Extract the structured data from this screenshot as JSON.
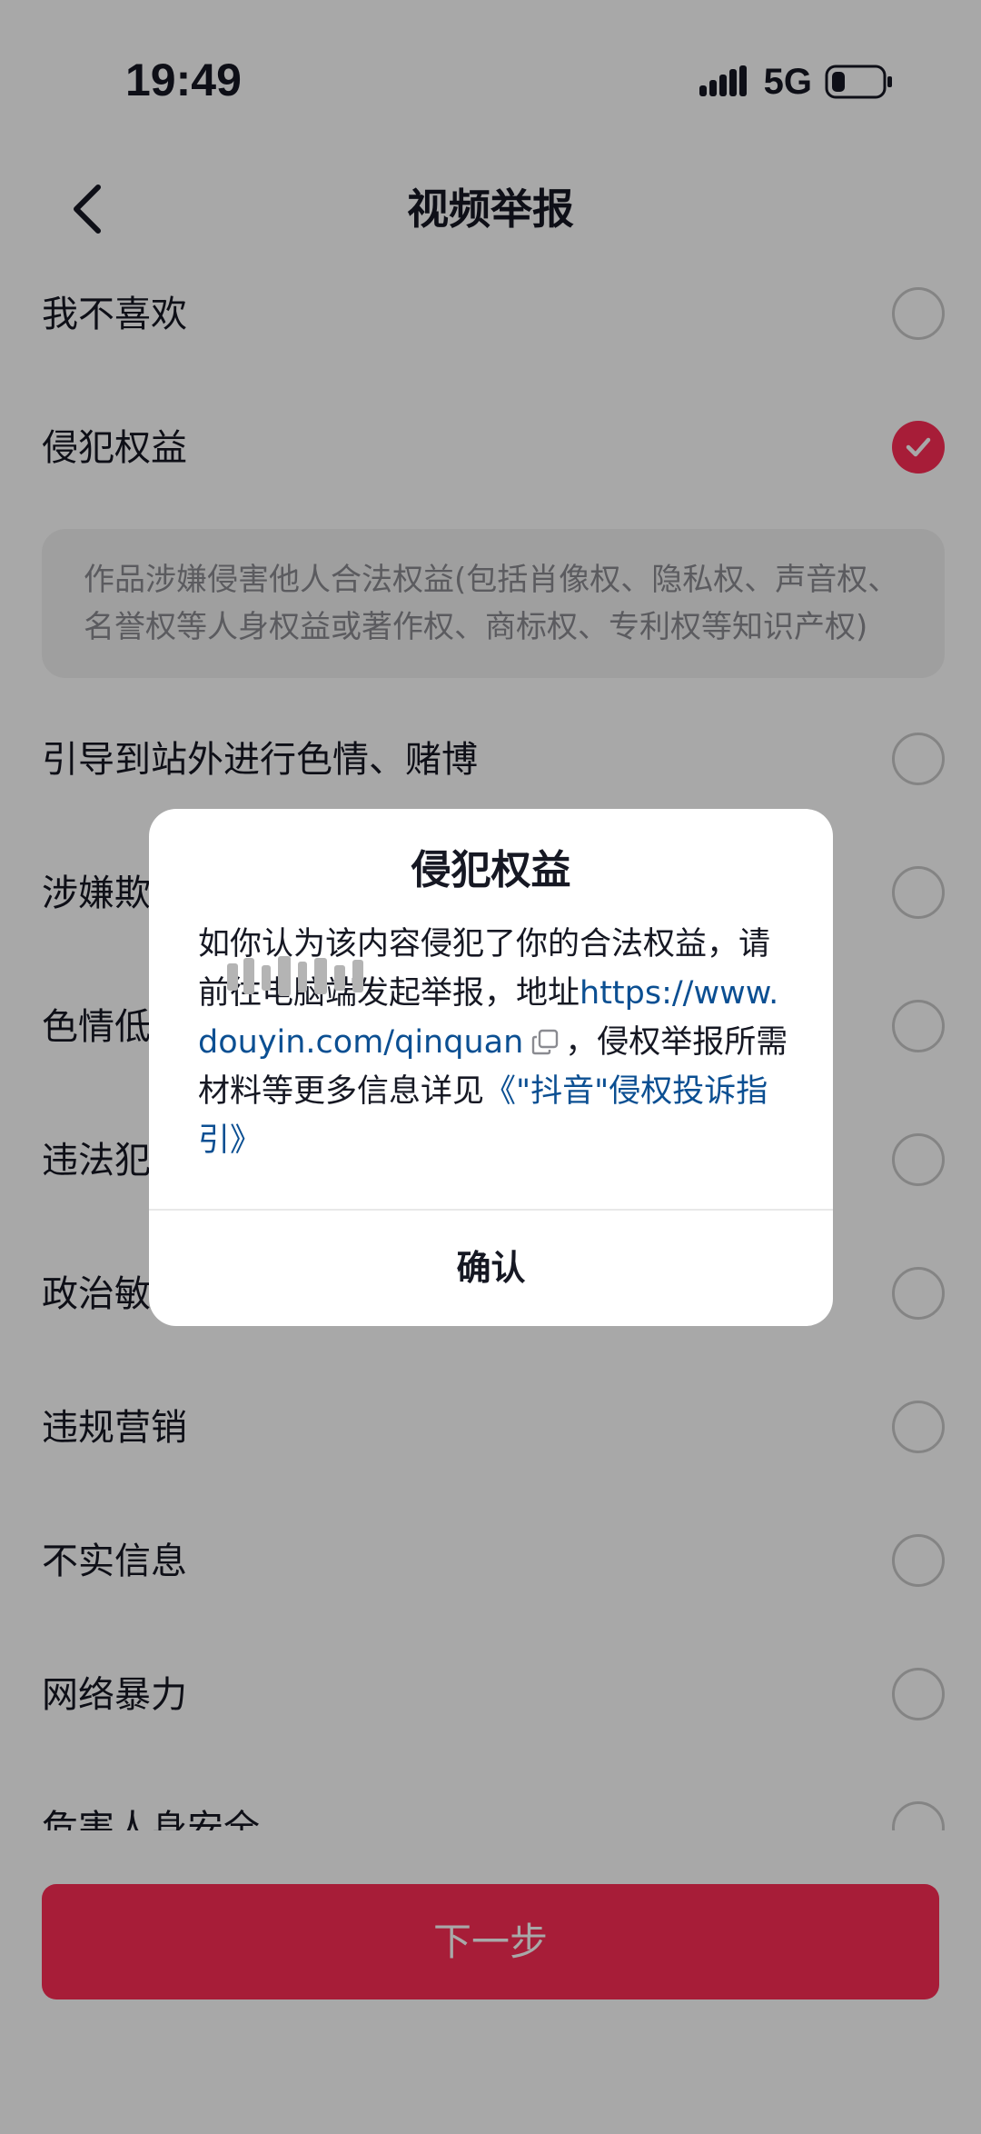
{
  "status_bar": {
    "time": "19:49",
    "network": "5G",
    "signal_icon": "signal-bars-icon",
    "battery_icon": "battery-low-icon"
  },
  "nav": {
    "title": "视频举报",
    "back_icon": "chevron-left-icon"
  },
  "reasons": [
    {
      "label": "我不喜欢",
      "checked": false
    },
    {
      "label": "侵犯权益",
      "checked": true,
      "description": "作品涉嫌侵害他人合法权益(包括肖像权、隐私权、声音权、名誉权等人身权益或著作权、商标权、专利权等知识产权)"
    },
    {
      "label": "引导到站外进行色情、赌博",
      "checked": false
    },
    {
      "label": "涉嫌欺",
      "checked": false
    },
    {
      "label": "色情低",
      "checked": false
    },
    {
      "label": "违法犯",
      "checked": false
    },
    {
      "label": "政治敏",
      "checked": false
    },
    {
      "label": "违规营销",
      "checked": false
    },
    {
      "label": "不实信息",
      "checked": false
    },
    {
      "label": "网络暴力",
      "checked": false
    },
    {
      "label": "危害人身安全",
      "checked": false
    }
  ],
  "next_button": "下一步",
  "dialog": {
    "title": "侵犯权益",
    "body_prefix": "如你认为该内容侵犯了你的合法权益，请前往电脑端发起举报，地址",
    "url": "https://www.douyin.com/qinquan",
    "copy_icon": "copy-icon",
    "body_middle": "，侵权举报所需材料等更多信息详见",
    "guide_link": "《\"抖音\"侵权投诉指引》",
    "confirm": "确认"
  },
  "colors": {
    "accent": "#fe2c55",
    "link": "#0b4f92",
    "mask": "rgba(0,0,0,0.34)"
  }
}
